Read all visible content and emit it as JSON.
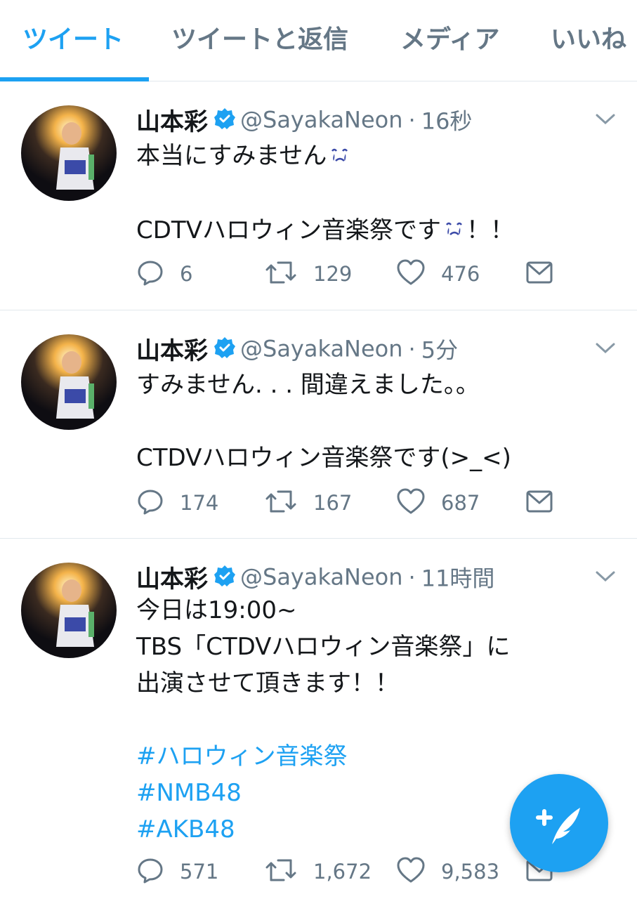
{
  "tabs": [
    {
      "label": "ツイート",
      "active": true
    },
    {
      "label": "ツイートと返信",
      "active": false
    },
    {
      "label": "メディア",
      "active": false
    },
    {
      "label": "いいね",
      "active": false
    }
  ],
  "tweets": [
    {
      "name": "山本彩",
      "handle": "@SayakaNeon",
      "separator": "·",
      "time": "16秒",
      "lines": [
        "本当にすみません",
        "",
        "CDTVハロウィン音楽祭です",
        "！！"
      ],
      "counts": {
        "reply": "6",
        "retweet": "129",
        "like": "476"
      }
    },
    {
      "name": "山本彩",
      "handle": "@SayakaNeon",
      "separator": "·",
      "time": "5分",
      "lines": [
        "すみません. . . 間違えました。。",
        "",
        "CTDVハロウィン音楽祭です(>_<)"
      ],
      "counts": {
        "reply": "174",
        "retweet": "167",
        "like": "687"
      }
    },
    {
      "name": "山本彩",
      "handle": "@SayakaNeon",
      "separator": "·",
      "time": "11時間",
      "lines": [
        "今日は19:00~",
        "TBS「CTDVハロウィン音楽祭」に",
        "出演させて頂きます！！",
        ""
      ],
      "hashtags": [
        "#ハロウィン音楽祭",
        "#NMB48",
        "#AKB48"
      ],
      "counts": {
        "reply": "571",
        "retweet": "1,672",
        "like": "9,583"
      }
    }
  ],
  "icons": {
    "verified": "verified-badge-icon",
    "caret": "chevron-down-icon",
    "reply": "reply-icon",
    "retweet": "retweet-icon",
    "like": "heart-icon",
    "dm": "envelope-icon",
    "compose": "compose-tweet-icon"
  },
  "colors": {
    "accent": "#1da1f2",
    "text": "#14171a",
    "muted": "#657786",
    "divider": "#e1e8ed"
  }
}
